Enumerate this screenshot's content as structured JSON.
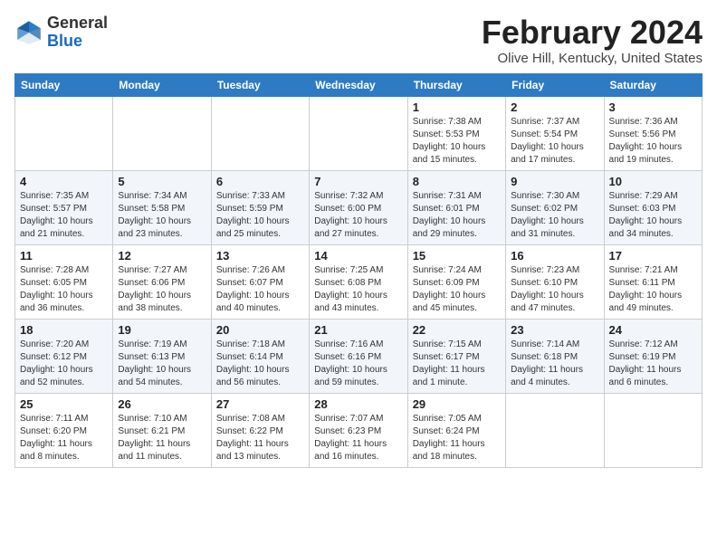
{
  "header": {
    "logo_general": "General",
    "logo_blue": "Blue",
    "month": "February 2024",
    "location": "Olive Hill, Kentucky, United States"
  },
  "days_of_week": [
    "Sunday",
    "Monday",
    "Tuesday",
    "Wednesday",
    "Thursday",
    "Friday",
    "Saturday"
  ],
  "weeks": [
    [
      {
        "day": "",
        "content": ""
      },
      {
        "day": "",
        "content": ""
      },
      {
        "day": "",
        "content": ""
      },
      {
        "day": "",
        "content": ""
      },
      {
        "day": "1",
        "content": "Sunrise: 7:38 AM\nSunset: 5:53 PM\nDaylight: 10 hours and 15 minutes."
      },
      {
        "day": "2",
        "content": "Sunrise: 7:37 AM\nSunset: 5:54 PM\nDaylight: 10 hours and 17 minutes."
      },
      {
        "day": "3",
        "content": "Sunrise: 7:36 AM\nSunset: 5:56 PM\nDaylight: 10 hours and 19 minutes."
      }
    ],
    [
      {
        "day": "4",
        "content": "Sunrise: 7:35 AM\nSunset: 5:57 PM\nDaylight: 10 hours and 21 minutes."
      },
      {
        "day": "5",
        "content": "Sunrise: 7:34 AM\nSunset: 5:58 PM\nDaylight: 10 hours and 23 minutes."
      },
      {
        "day": "6",
        "content": "Sunrise: 7:33 AM\nSunset: 5:59 PM\nDaylight: 10 hours and 25 minutes."
      },
      {
        "day": "7",
        "content": "Sunrise: 7:32 AM\nSunset: 6:00 PM\nDaylight: 10 hours and 27 minutes."
      },
      {
        "day": "8",
        "content": "Sunrise: 7:31 AM\nSunset: 6:01 PM\nDaylight: 10 hours and 29 minutes."
      },
      {
        "day": "9",
        "content": "Sunrise: 7:30 AM\nSunset: 6:02 PM\nDaylight: 10 hours and 31 minutes."
      },
      {
        "day": "10",
        "content": "Sunrise: 7:29 AM\nSunset: 6:03 PM\nDaylight: 10 hours and 34 minutes."
      }
    ],
    [
      {
        "day": "11",
        "content": "Sunrise: 7:28 AM\nSunset: 6:05 PM\nDaylight: 10 hours and 36 minutes."
      },
      {
        "day": "12",
        "content": "Sunrise: 7:27 AM\nSunset: 6:06 PM\nDaylight: 10 hours and 38 minutes."
      },
      {
        "day": "13",
        "content": "Sunrise: 7:26 AM\nSunset: 6:07 PM\nDaylight: 10 hours and 40 minutes."
      },
      {
        "day": "14",
        "content": "Sunrise: 7:25 AM\nSunset: 6:08 PM\nDaylight: 10 hours and 43 minutes."
      },
      {
        "day": "15",
        "content": "Sunrise: 7:24 AM\nSunset: 6:09 PM\nDaylight: 10 hours and 45 minutes."
      },
      {
        "day": "16",
        "content": "Sunrise: 7:23 AM\nSunset: 6:10 PM\nDaylight: 10 hours and 47 minutes."
      },
      {
        "day": "17",
        "content": "Sunrise: 7:21 AM\nSunset: 6:11 PM\nDaylight: 10 hours and 49 minutes."
      }
    ],
    [
      {
        "day": "18",
        "content": "Sunrise: 7:20 AM\nSunset: 6:12 PM\nDaylight: 10 hours and 52 minutes."
      },
      {
        "day": "19",
        "content": "Sunrise: 7:19 AM\nSunset: 6:13 PM\nDaylight: 10 hours and 54 minutes."
      },
      {
        "day": "20",
        "content": "Sunrise: 7:18 AM\nSunset: 6:14 PM\nDaylight: 10 hours and 56 minutes."
      },
      {
        "day": "21",
        "content": "Sunrise: 7:16 AM\nSunset: 6:16 PM\nDaylight: 10 hours and 59 minutes."
      },
      {
        "day": "22",
        "content": "Sunrise: 7:15 AM\nSunset: 6:17 PM\nDaylight: 11 hours and 1 minute."
      },
      {
        "day": "23",
        "content": "Sunrise: 7:14 AM\nSunset: 6:18 PM\nDaylight: 11 hours and 4 minutes."
      },
      {
        "day": "24",
        "content": "Sunrise: 7:12 AM\nSunset: 6:19 PM\nDaylight: 11 hours and 6 minutes."
      }
    ],
    [
      {
        "day": "25",
        "content": "Sunrise: 7:11 AM\nSunset: 6:20 PM\nDaylight: 11 hours and 8 minutes."
      },
      {
        "day": "26",
        "content": "Sunrise: 7:10 AM\nSunset: 6:21 PM\nDaylight: 11 hours and 11 minutes."
      },
      {
        "day": "27",
        "content": "Sunrise: 7:08 AM\nSunset: 6:22 PM\nDaylight: 11 hours and 13 minutes."
      },
      {
        "day": "28",
        "content": "Sunrise: 7:07 AM\nSunset: 6:23 PM\nDaylight: 11 hours and 16 minutes."
      },
      {
        "day": "29",
        "content": "Sunrise: 7:05 AM\nSunset: 6:24 PM\nDaylight: 11 hours and 18 minutes."
      },
      {
        "day": "",
        "content": ""
      },
      {
        "day": "",
        "content": ""
      }
    ]
  ]
}
